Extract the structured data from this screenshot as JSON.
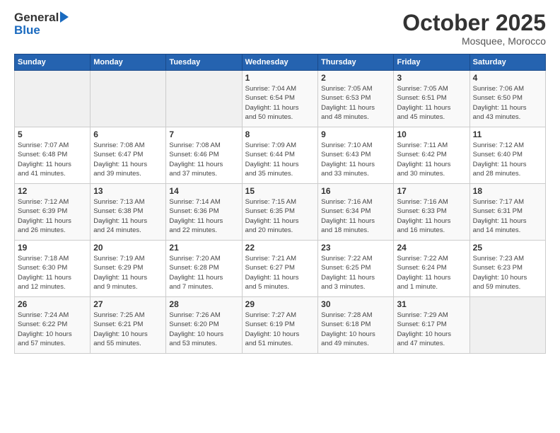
{
  "header": {
    "logo_line1": "General",
    "logo_line2": "Blue",
    "month": "October 2025",
    "location": "Mosquee, Morocco"
  },
  "days_of_week": [
    "Sunday",
    "Monday",
    "Tuesday",
    "Wednesday",
    "Thursday",
    "Friday",
    "Saturday"
  ],
  "weeks": [
    [
      {
        "day": "",
        "info": ""
      },
      {
        "day": "",
        "info": ""
      },
      {
        "day": "",
        "info": ""
      },
      {
        "day": "1",
        "info": "Sunrise: 7:04 AM\nSunset: 6:54 PM\nDaylight: 11 hours\nand 50 minutes."
      },
      {
        "day": "2",
        "info": "Sunrise: 7:05 AM\nSunset: 6:53 PM\nDaylight: 11 hours\nand 48 minutes."
      },
      {
        "day": "3",
        "info": "Sunrise: 7:05 AM\nSunset: 6:51 PM\nDaylight: 11 hours\nand 45 minutes."
      },
      {
        "day": "4",
        "info": "Sunrise: 7:06 AM\nSunset: 6:50 PM\nDaylight: 11 hours\nand 43 minutes."
      }
    ],
    [
      {
        "day": "5",
        "info": "Sunrise: 7:07 AM\nSunset: 6:48 PM\nDaylight: 11 hours\nand 41 minutes."
      },
      {
        "day": "6",
        "info": "Sunrise: 7:08 AM\nSunset: 6:47 PM\nDaylight: 11 hours\nand 39 minutes."
      },
      {
        "day": "7",
        "info": "Sunrise: 7:08 AM\nSunset: 6:46 PM\nDaylight: 11 hours\nand 37 minutes."
      },
      {
        "day": "8",
        "info": "Sunrise: 7:09 AM\nSunset: 6:44 PM\nDaylight: 11 hours\nand 35 minutes."
      },
      {
        "day": "9",
        "info": "Sunrise: 7:10 AM\nSunset: 6:43 PM\nDaylight: 11 hours\nand 33 minutes."
      },
      {
        "day": "10",
        "info": "Sunrise: 7:11 AM\nSunset: 6:42 PM\nDaylight: 11 hours\nand 30 minutes."
      },
      {
        "day": "11",
        "info": "Sunrise: 7:12 AM\nSunset: 6:40 PM\nDaylight: 11 hours\nand 28 minutes."
      }
    ],
    [
      {
        "day": "12",
        "info": "Sunrise: 7:12 AM\nSunset: 6:39 PM\nDaylight: 11 hours\nand 26 minutes."
      },
      {
        "day": "13",
        "info": "Sunrise: 7:13 AM\nSunset: 6:38 PM\nDaylight: 11 hours\nand 24 minutes."
      },
      {
        "day": "14",
        "info": "Sunrise: 7:14 AM\nSunset: 6:36 PM\nDaylight: 11 hours\nand 22 minutes."
      },
      {
        "day": "15",
        "info": "Sunrise: 7:15 AM\nSunset: 6:35 PM\nDaylight: 11 hours\nand 20 minutes."
      },
      {
        "day": "16",
        "info": "Sunrise: 7:16 AM\nSunset: 6:34 PM\nDaylight: 11 hours\nand 18 minutes."
      },
      {
        "day": "17",
        "info": "Sunrise: 7:16 AM\nSunset: 6:33 PM\nDaylight: 11 hours\nand 16 minutes."
      },
      {
        "day": "18",
        "info": "Sunrise: 7:17 AM\nSunset: 6:31 PM\nDaylight: 11 hours\nand 14 minutes."
      }
    ],
    [
      {
        "day": "19",
        "info": "Sunrise: 7:18 AM\nSunset: 6:30 PM\nDaylight: 11 hours\nand 12 minutes."
      },
      {
        "day": "20",
        "info": "Sunrise: 7:19 AM\nSunset: 6:29 PM\nDaylight: 11 hours\nand 9 minutes."
      },
      {
        "day": "21",
        "info": "Sunrise: 7:20 AM\nSunset: 6:28 PM\nDaylight: 11 hours\nand 7 minutes."
      },
      {
        "day": "22",
        "info": "Sunrise: 7:21 AM\nSunset: 6:27 PM\nDaylight: 11 hours\nand 5 minutes."
      },
      {
        "day": "23",
        "info": "Sunrise: 7:22 AM\nSunset: 6:25 PM\nDaylight: 11 hours\nand 3 minutes."
      },
      {
        "day": "24",
        "info": "Sunrise: 7:22 AM\nSunset: 6:24 PM\nDaylight: 11 hours\nand 1 minute."
      },
      {
        "day": "25",
        "info": "Sunrise: 7:23 AM\nSunset: 6:23 PM\nDaylight: 10 hours\nand 59 minutes."
      }
    ],
    [
      {
        "day": "26",
        "info": "Sunrise: 7:24 AM\nSunset: 6:22 PM\nDaylight: 10 hours\nand 57 minutes."
      },
      {
        "day": "27",
        "info": "Sunrise: 7:25 AM\nSunset: 6:21 PM\nDaylight: 10 hours\nand 55 minutes."
      },
      {
        "day": "28",
        "info": "Sunrise: 7:26 AM\nSunset: 6:20 PM\nDaylight: 10 hours\nand 53 minutes."
      },
      {
        "day": "29",
        "info": "Sunrise: 7:27 AM\nSunset: 6:19 PM\nDaylight: 10 hours\nand 51 minutes."
      },
      {
        "day": "30",
        "info": "Sunrise: 7:28 AM\nSunset: 6:18 PM\nDaylight: 10 hours\nand 49 minutes."
      },
      {
        "day": "31",
        "info": "Sunrise: 7:29 AM\nSunset: 6:17 PM\nDaylight: 10 hours\nand 47 minutes."
      },
      {
        "day": "",
        "info": ""
      }
    ]
  ]
}
